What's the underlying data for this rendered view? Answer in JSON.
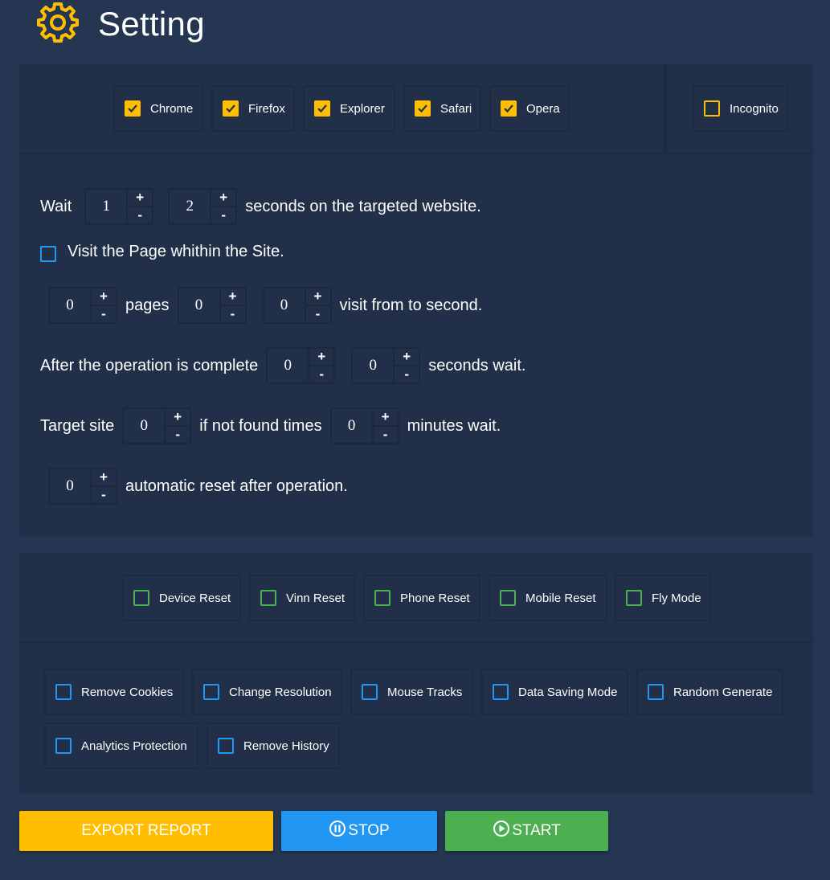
{
  "header": {
    "title": "Setting",
    "icon": "gear-icon"
  },
  "browsers": [
    {
      "label": "Chrome",
      "checked": true
    },
    {
      "label": "Firefox",
      "checked": true
    },
    {
      "label": "Explorer",
      "checked": true
    },
    {
      "label": "Safari",
      "checked": true
    },
    {
      "label": "Opera",
      "checked": true
    }
  ],
  "incognito": {
    "label": "Incognito",
    "checked": false
  },
  "timing": {
    "wait_label": "Wait",
    "wait_min": "1",
    "wait_max": "2",
    "wait_suffix": "seconds on the targeted website.",
    "visit_page_label": "Visit the Page whithin the Site.",
    "pages_value": "0",
    "pages_label": "pages",
    "from_value": "0",
    "to_value": "0",
    "visit_suffix": "visit from to second.",
    "after_label": "After the operation is complete",
    "after_min": "0",
    "after_max": "0",
    "after_suffix": "seconds wait.",
    "target_label": "Target site",
    "target_times": "0",
    "not_found_label": "if not found times",
    "target_minutes": "0",
    "minutes_suffix": "minutes wait.",
    "reset_value": "0",
    "reset_suffix": "automatic reset after operation.",
    "plus": "+",
    "minus": "-"
  },
  "reset_options": [
    {
      "label": "Device Reset"
    },
    {
      "label": "Vinn Reset"
    },
    {
      "label": "Phone Reset"
    },
    {
      "label": "Mobile Reset"
    },
    {
      "label": "Fly Mode"
    }
  ],
  "extra_options": [
    {
      "label": "Remove Cookies"
    },
    {
      "label": "Change Resolution"
    },
    {
      "label": "Mouse Tracks"
    },
    {
      "label": "Data Saving Mode"
    },
    {
      "label": "Random Generate"
    },
    {
      "label": "Analytics Protection"
    },
    {
      "label": "Remove History"
    }
  ],
  "actions": {
    "export_label": "EXPORT REPORT",
    "stop_label": "STOP",
    "start_label": "START"
  },
  "colors": {
    "background": "#243651",
    "panel": "#213048",
    "accent_yellow": "#FFBF00",
    "blue": "#2196F3",
    "green": "#4CAF50"
  }
}
